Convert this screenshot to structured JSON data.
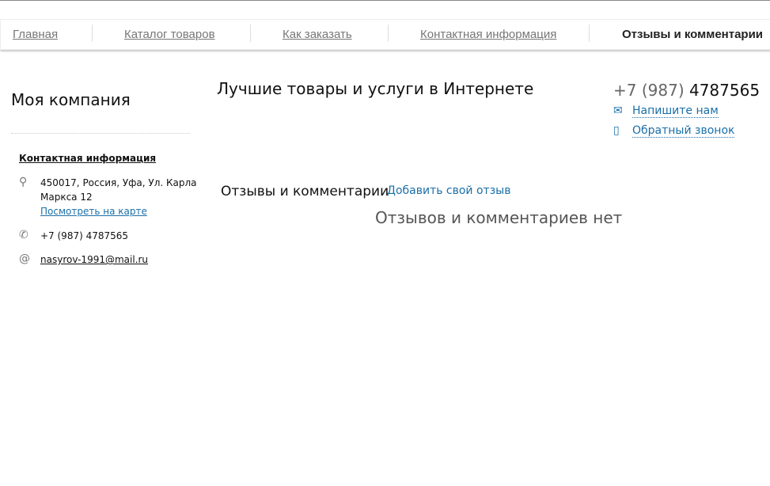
{
  "nav": {
    "items": [
      {
        "label": "Главная"
      },
      {
        "label": "Каталог товаров"
      },
      {
        "label": "Как заказать"
      },
      {
        "label": "Контактная информация"
      },
      {
        "label": "Отзывы и комментарии"
      }
    ]
  },
  "header": {
    "company": "Моя компания",
    "slogan": "Лучшие товары и услуги в Интернете",
    "phone_code": "+7 (987)",
    "phone_number": "4787565",
    "write_us": "Напишите нам",
    "callback": "Обратный звонок"
  },
  "sidebar": {
    "title": "Контактная информация",
    "address": "450017, Россия, Уфа, Ул. Карла Маркса 12",
    "map_link": "Посмотреть на карте",
    "phone": "+7 (987) 4787565",
    "email": "nasyrov-1991@mail.ru"
  },
  "main": {
    "title": "Отзывы и комментарии",
    "add_review": "Добавить свой отзыв",
    "empty": "Отзывов и комментариев нет"
  },
  "colors": {
    "link": "#1a6fa8"
  }
}
